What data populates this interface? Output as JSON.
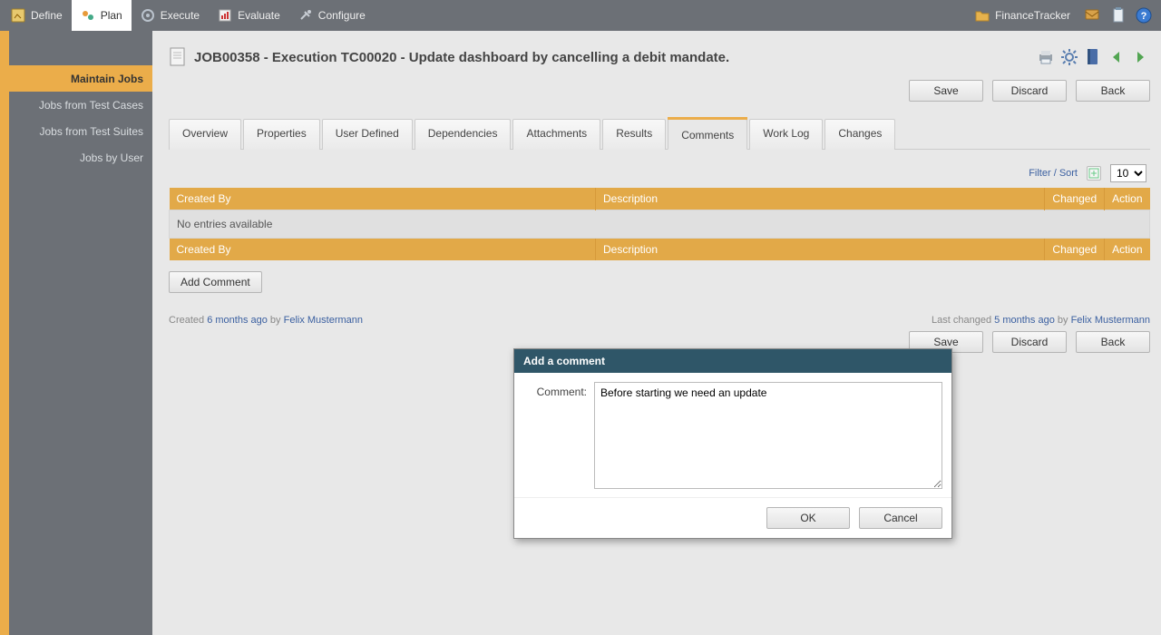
{
  "topnav": {
    "items": [
      {
        "label": "Define"
      },
      {
        "label": "Plan"
      },
      {
        "label": "Execute"
      },
      {
        "label": "Evaluate"
      },
      {
        "label": "Configure"
      }
    ],
    "active_index": 1,
    "project_label": "FinanceTracker"
  },
  "sidebar": {
    "items": [
      {
        "label": "Maintain Jobs",
        "active": true
      },
      {
        "label": "Jobs from Test Cases"
      },
      {
        "label": "Jobs from Test Suites"
      },
      {
        "label": "Jobs by User"
      }
    ]
  },
  "page": {
    "title": "JOB00358 - Execution TC00020 - Update dashboard by cancelling a debit mandate."
  },
  "actions": {
    "save": "Save",
    "discard": "Discard",
    "back": "Back"
  },
  "tabs": {
    "items": [
      "Overview",
      "Properties",
      "User Defined",
      "Dependencies",
      "Attachments",
      "Results",
      "Comments",
      "Work Log",
      "Changes"
    ],
    "active_index": 6
  },
  "comments_panel": {
    "filter_sort_label": "Filter / Sort",
    "page_size": "10",
    "columns": {
      "created_by": "Created By",
      "description": "Description",
      "changed": "Changed",
      "action": "Action"
    },
    "empty_text": "No entries available",
    "add_comment_label": "Add Comment"
  },
  "meta": {
    "created_prefix": "Created",
    "created_time": "6 months ago",
    "created_by_word": "by",
    "created_user": "Felix Mustermann",
    "changed_prefix": "Last changed",
    "changed_time": "5 months ago",
    "changed_by_word": "by",
    "changed_user": "Felix Mustermann"
  },
  "dialog": {
    "title": "Add a comment",
    "field_label": "Comment:",
    "value": "Before starting we need an update",
    "ok": "OK",
    "cancel": "Cancel"
  }
}
